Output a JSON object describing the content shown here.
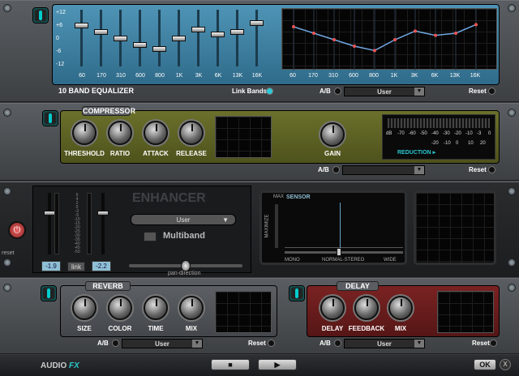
{
  "eq": {
    "title": "10 BAND EQUALIZER",
    "link_label": "Link Bands",
    "ab_label": "A/B",
    "preset": "User",
    "reset_label": "Reset",
    "db_ticks": [
      "+12",
      "+6",
      "0",
      "-6",
      "-12"
    ],
    "bands": [
      "60",
      "170",
      "310",
      "600",
      "800",
      "1K",
      "3K",
      "6K",
      "13K",
      "16K"
    ],
    "band_gains": [
      6,
      3,
      0,
      -3,
      -5,
      0,
      4,
      2,
      3,
      7
    ]
  },
  "compressor": {
    "title": "COMPRESSOR",
    "knobs": [
      "THRESHOLD",
      "RATIO",
      "ATTACK",
      "RELEASE"
    ],
    "gain_label": "GAIN",
    "meter_top": [
      "dB",
      "-70",
      "-60",
      "-50",
      "-40",
      "-30",
      "-20",
      "-10",
      "-3",
      "0"
    ],
    "meter_bottom": [
      "-20",
      "-10",
      "0",
      "10",
      "20"
    ],
    "reduction_label": "REDUCTION",
    "ab_label": "A/B",
    "reset_label": "Reset"
  },
  "enhancer": {
    "title": "ENHANCER",
    "preset": "User",
    "multiband_label": "Multiband",
    "scale": [
      "6",
      "4",
      "2",
      "0",
      "-2",
      "-5",
      "-10",
      "-15",
      "-20",
      "-25",
      "-30",
      "-35",
      "-40",
      "-45",
      "-50"
    ],
    "left_value": "-1.9",
    "link_label": "link",
    "right_value": "-2.2",
    "pan_label": "pan-direction",
    "sensor_title": "SENSOR",
    "sensor_max_label": "MAX",
    "maximize_label": "MAXIMIZE",
    "mono_label": "MONO",
    "normal_label": "NORMAL-STEREO",
    "wide_label": "WIDE",
    "reset_label": "reset"
  },
  "reverb": {
    "title": "REVERB",
    "knobs": [
      "SIZE",
      "COLOR",
      "TIME",
      "MIX"
    ],
    "ab_label": "A/B",
    "preset": "User",
    "reset_label": "Reset"
  },
  "delay": {
    "title": "DELAY",
    "knobs": [
      "DELAY",
      "FEEDBACK",
      "MIX"
    ],
    "ab_label": "A/B",
    "preset": "User",
    "reset_label": "Reset"
  },
  "footer": {
    "app_label": "AUDIO",
    "app_label_accent": "FX",
    "ok_label": "OK",
    "close_label": "X"
  },
  "colors": {
    "eq_panel": "#4a8fb0",
    "comp_panel": "#5f6324",
    "delay_panel": "#6a1d1d",
    "accent": "#29c7d0"
  }
}
